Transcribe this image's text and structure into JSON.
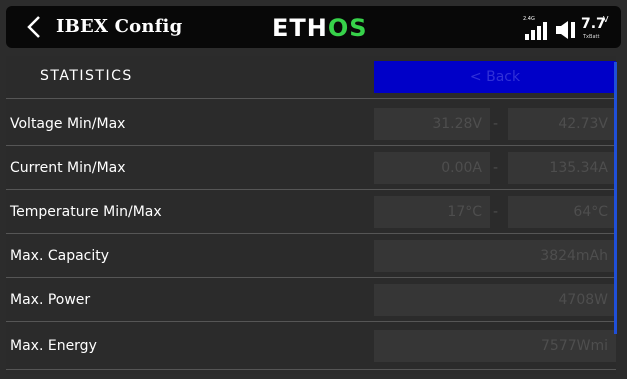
{
  "titlebar": {
    "title": "IBEX Config",
    "logo_left": "ETH",
    "logo_right": "OS",
    "signal_label": "2.4G",
    "battery_value": "7.7",
    "battery_unit": "V",
    "battery_label": "TxBatt"
  },
  "section": {
    "title": "STATISTICS",
    "back_label": "< Back"
  },
  "rows": [
    {
      "label": "Voltage Min/Max",
      "min": "31.28V",
      "max": "42.73V"
    },
    {
      "label": "Current Min/Max",
      "min": "0.00A",
      "max": "135.34A"
    },
    {
      "label": "Temperature Min/Max",
      "min": "17°C",
      "max": "64°C"
    },
    {
      "label": "Max. Capacity",
      "value": "3824mAh"
    },
    {
      "label": "Max. Power",
      "value": "4708W"
    },
    {
      "label": "Max. Energy",
      "value": "7577Wmi"
    }
  ],
  "separator": "-",
  "colors": {
    "accent_blue": "#0000c8",
    "logo_green": "#37d24a",
    "scrollbar": "#1f4fd8"
  }
}
